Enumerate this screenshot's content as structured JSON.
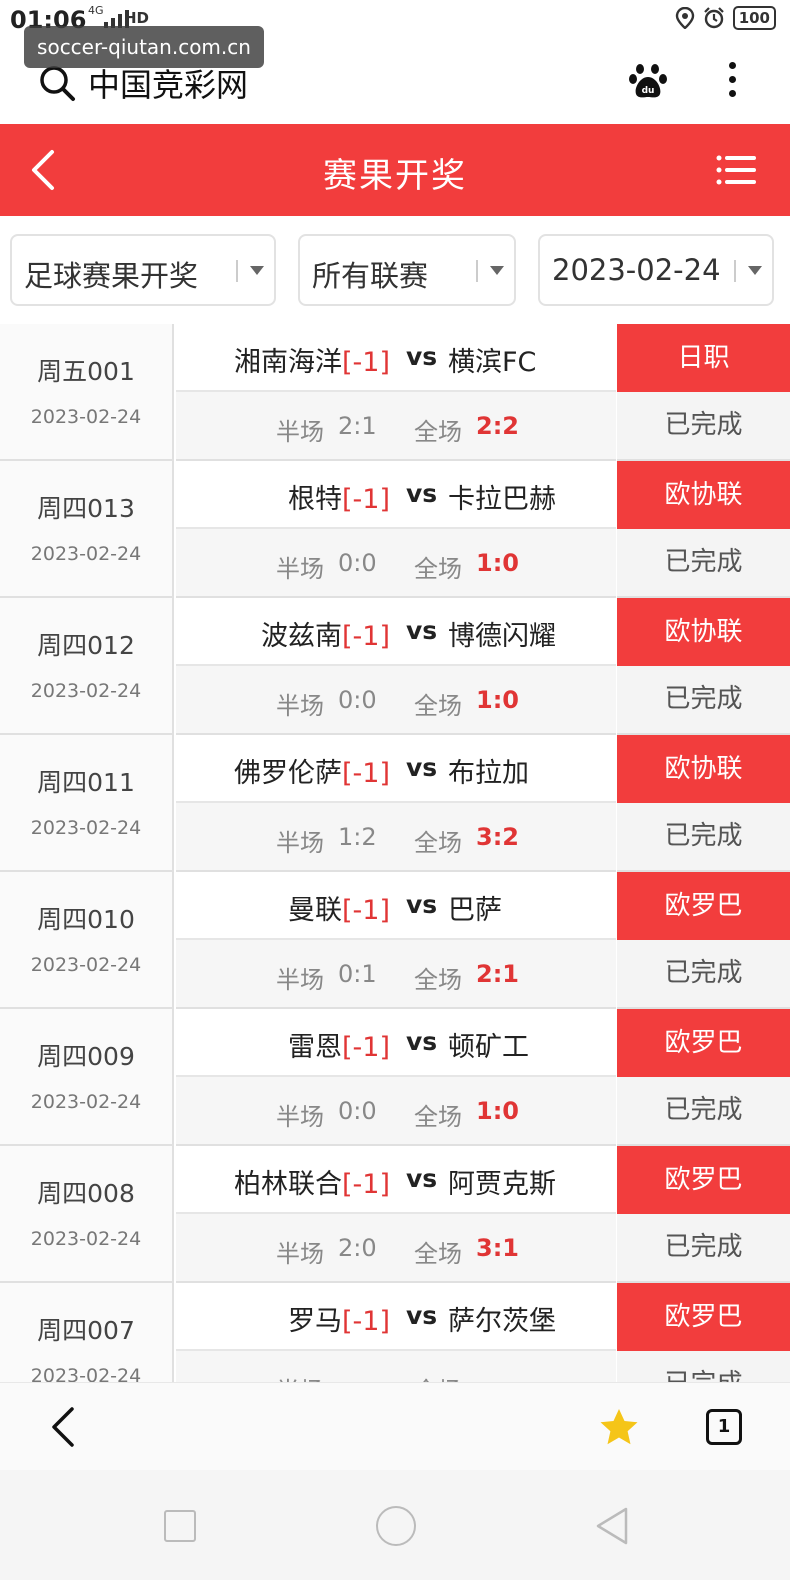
{
  "status_bar": {
    "time": "01:06",
    "network": "4G",
    "hd": "HD",
    "battery": "100"
  },
  "watermark": "soccer-qiutan.com.cn",
  "browser": {
    "site_title": "中国竞彩网"
  },
  "header": {
    "title": "赛果开奖"
  },
  "filters": [
    {
      "label": "足球赛果开奖"
    },
    {
      "label": "所有联赛"
    },
    {
      "label": "2023-02-24"
    }
  ],
  "labels": {
    "vs": "vs",
    "half": "半场",
    "full": "全场"
  },
  "matches": [
    {
      "num": "周五001",
      "date": "2023-02-24",
      "home": "湘南海洋",
      "handicap": "[-1]",
      "away": "横滨FC",
      "ht": "2:1",
      "ft": "2:2",
      "league": "日职",
      "status": "已完成"
    },
    {
      "num": "周四013",
      "date": "2023-02-24",
      "home": "根特",
      "handicap": "[-1]",
      "away": "卡拉巴赫",
      "ht": "0:0",
      "ft": "1:0",
      "league": "欧协联",
      "status": "已完成"
    },
    {
      "num": "周四012",
      "date": "2023-02-24",
      "home": "波兹南",
      "handicap": "[-1]",
      "away": "博德闪耀",
      "ht": "0:0",
      "ft": "1:0",
      "league": "欧协联",
      "status": "已完成"
    },
    {
      "num": "周四011",
      "date": "2023-02-24",
      "home": "佛罗伦萨",
      "handicap": "[-1]",
      "away": "布拉加",
      "ht": "1:2",
      "ft": "3:2",
      "league": "欧协联",
      "status": "已完成"
    },
    {
      "num": "周四010",
      "date": "2023-02-24",
      "home": "曼联",
      "handicap": "[-1]",
      "away": "巴萨",
      "ht": "0:1",
      "ft": "2:1",
      "league": "欧罗巴",
      "status": "已完成"
    },
    {
      "num": "周四009",
      "date": "2023-02-24",
      "home": "雷恩",
      "handicap": "[-1]",
      "away": "顿矿工",
      "ht": "0:0",
      "ft": "1:0",
      "league": "欧罗巴",
      "status": "已完成"
    },
    {
      "num": "周四008",
      "date": "2023-02-24",
      "home": "柏林联合",
      "handicap": "[-1]",
      "away": "阿贾克斯",
      "ht": "2:0",
      "ft": "3:1",
      "league": "欧罗巴",
      "status": "已完成"
    },
    {
      "num": "周四007",
      "date": "2023-02-24",
      "home": "罗马",
      "handicap": "[-1]",
      "away": "萨尔茨堡",
      "ht": "",
      "ft": "",
      "league": "欧罗巴",
      "status": "已完成"
    }
  ],
  "bottom_bar": {
    "tab_count": "1"
  }
}
